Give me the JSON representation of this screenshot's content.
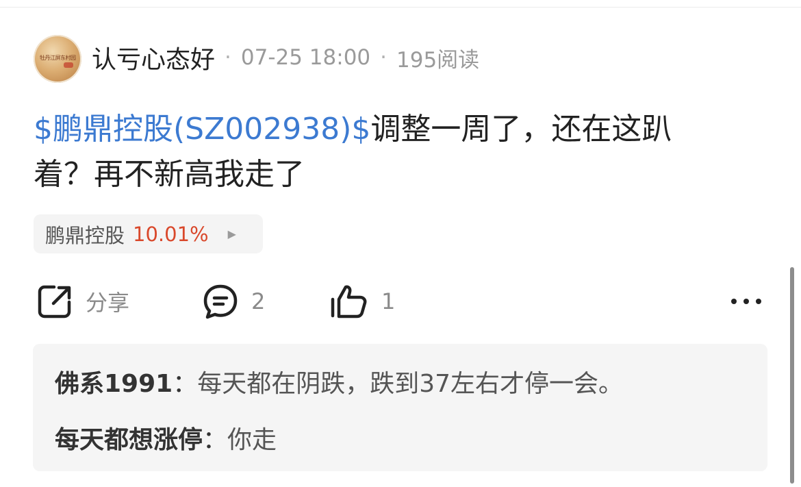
{
  "post": {
    "author": "认亏心态好",
    "date": "07-25 18:00",
    "reads": "195阅读",
    "separator": "·",
    "stock_link": "$鹏鼎控股(SZ002938)$",
    "text_line1": "调整一周了，还在这趴",
    "text_line2": "着？再不新高我走了"
  },
  "avatar": {
    "text": "牡丹江屏东村园"
  },
  "stock_chip": {
    "name": "鹏鼎控股",
    "change": "10.01%",
    "change_color": "#d9482b",
    "arrow_icon": "play-triangle-icon"
  },
  "actions": {
    "share_label": "分享",
    "comment_count": "2",
    "like_count": "1",
    "icons": [
      "share-icon",
      "comment-icon",
      "thumbs-up-icon",
      "more-icon"
    ]
  },
  "comments": [
    {
      "author": "佛系1991",
      "colon": "：",
      "text": "每天都在阴跌，跌到37左右才停一会。"
    },
    {
      "author": "每天都想涨停",
      "colon": "：",
      "text": "你走"
    }
  ],
  "colors": {
    "link_blue": "#3c7ad1",
    "text_dark": "#222222",
    "meta_gray": "#9a9a9a",
    "panel_bg": "#f5f5f5"
  }
}
